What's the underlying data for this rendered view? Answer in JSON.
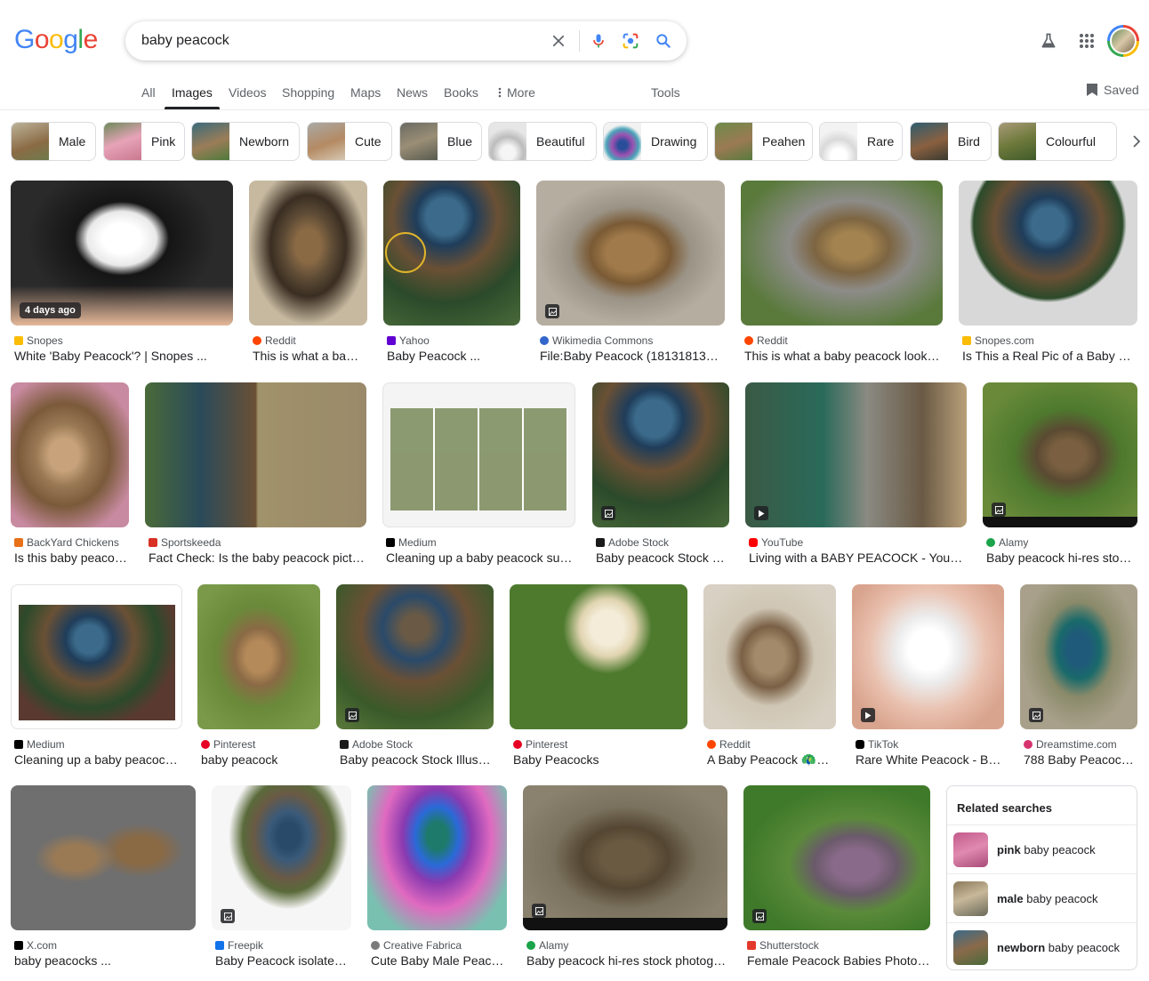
{
  "header": {
    "logo_letters": [
      "G",
      "o",
      "o",
      "g",
      "l",
      "e"
    ],
    "logo_colors": [
      "#4285f4",
      "#ea4335",
      "#fbbc04",
      "#4285f4",
      "#34a853",
      "#ea4335"
    ],
    "search_value": "baby peacock"
  },
  "tabs": {
    "all": "All",
    "images": "Images",
    "videos": "Videos",
    "shopping": "Shopping",
    "maps": "Maps",
    "news": "News",
    "books": "Books",
    "more": "More",
    "tools": "Tools",
    "saved": "Saved"
  },
  "chips": [
    "Male",
    "Pink",
    "Newborn",
    "Cute",
    "Blue",
    "Beautiful",
    "Drawing",
    "Peahen",
    "Rare",
    "Bird",
    "Colourful"
  ],
  "results": [
    {
      "source": "Snopes",
      "title": "White 'Baby Peacock'? | Snopes ...",
      "badge": "4 days ago",
      "fav": "#fbbc04"
    },
    {
      "source": "Reddit",
      "title": "This is what a baby ...",
      "fav": "#ff4500"
    },
    {
      "source": "Yahoo",
      "title": "Baby Peacock ...",
      "fav": "#6001d2"
    },
    {
      "source": "Wikimedia Commons",
      "title": "File:Baby Peacock (18131813108...",
      "fav": "#3366cc"
    },
    {
      "source": "Reddit",
      "title": "This is what a baby peacock looks li...",
      "fav": "#ff4500"
    },
    {
      "source": "Snopes.com",
      "title": "Is This a Real Pic of a Baby Pea...",
      "fav": "#fbbc04"
    },
    {
      "source": "BackYard Chickens",
      "title": "Is this baby peacoc...",
      "fav": "#e8711a"
    },
    {
      "source": "Sportskeeda",
      "title": "Fact Check: Is the baby peacock picture...",
      "fav": "#d93025"
    },
    {
      "source": "Medium",
      "title": "Cleaning up a baby peacock sullie...",
      "fav": "#000000"
    },
    {
      "source": "Adobe Stock",
      "title": "Baby peacock Stock Ill...",
      "fav": "#1a1a1a"
    },
    {
      "source": "YouTube",
      "title": "Living with a BABY PEACOCK - YouTube",
      "fav": "#ff0000"
    },
    {
      "source": "Alamy",
      "title": "Baby peacock hi-res stock ...",
      "fav": "#1aa34a"
    },
    {
      "source": "Medium",
      "title": "Cleaning up a baby peacock s...",
      "fav": "#000000"
    },
    {
      "source": "Pinterest",
      "title": "baby peacock",
      "fav": "#e60023"
    },
    {
      "source": "Adobe Stock",
      "title": "Baby peacock Stock Illustr...",
      "fav": "#1a1a1a"
    },
    {
      "source": "Pinterest",
      "title": "Baby Peacocks",
      "fav": "#e60023"
    },
    {
      "source": "Reddit",
      "title": "A Baby Peacock 🦚💙 ...",
      "fav": "#ff4500"
    },
    {
      "source": "TikTok",
      "title": "Rare White Peacock - Bab...",
      "fav": "#000000"
    },
    {
      "source": "Dreamstime.com",
      "title": "788 Baby Peacock ...",
      "fav": "#d6336c"
    },
    {
      "source": "X.com",
      "title": "baby peacocks ...",
      "fav": "#000000"
    },
    {
      "source": "Freepik",
      "title": "Baby Peacock isolated ...",
      "fav": "#1273eb"
    },
    {
      "source": "Creative Fabrica",
      "title": "Cute Baby Male Peacoc...",
      "fav": "#7a7a7a"
    },
    {
      "source": "Alamy",
      "title": "Baby peacock hi-res stock photogra...",
      "fav": "#1aa34a"
    },
    {
      "source": "Shutterstock",
      "title": "Female Peacock Babies Photos, ...",
      "fav": "#e3392c"
    }
  ],
  "related": {
    "title": "Related searches",
    "items": [
      {
        "bold": "pink",
        "rest": " baby peacock"
      },
      {
        "bold": "male",
        "rest": " baby peacock"
      },
      {
        "bold": "newborn",
        "rest": " baby peacock"
      }
    ]
  }
}
